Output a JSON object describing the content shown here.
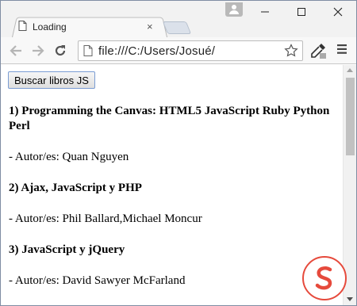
{
  "window": {
    "tab": {
      "title": "Loading",
      "icon": "document-icon"
    },
    "controls": {
      "minimize_icon": "minimize-icon",
      "maximize_icon": "maximize-icon",
      "close_icon": "close-icon"
    }
  },
  "toolbar": {
    "url": "file:///C:/Users/Josué/",
    "back_icon": "arrow-left-icon",
    "forward_icon": "arrow-right-icon",
    "reload_icon": "reload-icon",
    "bookmark_icon": "star-icon",
    "extension_icon": "eyedropper-icon",
    "menu_icon": "hamburger-menu-icon"
  },
  "page": {
    "button_label": "Buscar libros JS",
    "books": [
      {
        "title": "1) Programming the Canvas: HTML5 JavaScript Ruby Python Perl",
        "author": "- Autor/es: Quan Nguyen"
      },
      {
        "title": "2) Ajax, JavaScript y PHP",
        "author": "- Autor/es: Phil Ballard,Michael Moncur"
      },
      {
        "title": "3) JavaScript y jQuery",
        "author": "- Autor/es: David Sawyer McFarland"
      }
    ]
  },
  "colors": {
    "accent_button_border": "#7a9cd3",
    "watermark": "#e64a3c"
  }
}
